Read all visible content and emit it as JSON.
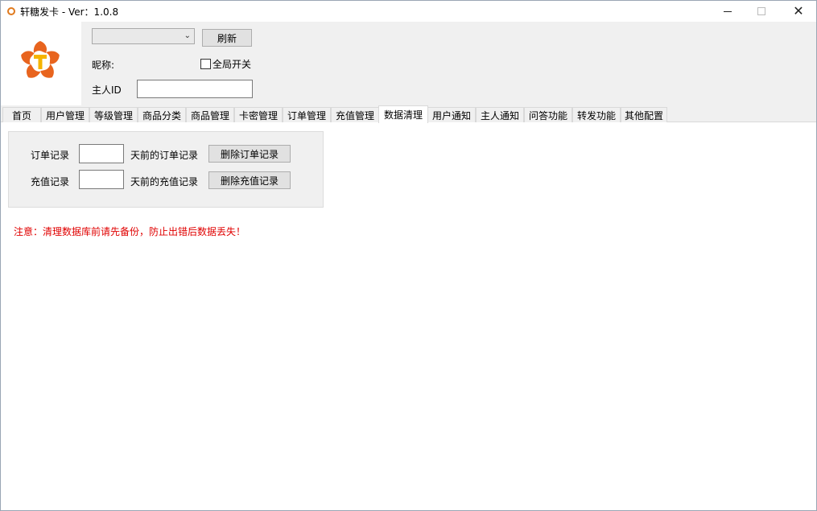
{
  "window": {
    "title": "轩糖发卡 - Ver：1.0.8"
  },
  "header": {
    "combo_value": "",
    "refresh_label": "刷新",
    "nickname_label": "昵称:",
    "global_switch_label": "全局开关",
    "owner_id_label": "主人ID",
    "owner_id_value": ""
  },
  "tabs": [
    {
      "label": "首页"
    },
    {
      "label": "用户管理"
    },
    {
      "label": "等级管理"
    },
    {
      "label": "商品分类"
    },
    {
      "label": "商品管理"
    },
    {
      "label": "卡密管理"
    },
    {
      "label": "订单管理"
    },
    {
      "label": "充值管理"
    },
    {
      "label": "数据清理"
    },
    {
      "label": "用户通知"
    },
    {
      "label": "主人通知"
    },
    {
      "label": "问答功能"
    },
    {
      "label": "转发功能"
    },
    {
      "label": "其他配置"
    }
  ],
  "active_tab": "数据清理",
  "cleanup": {
    "order_label": "订单记录",
    "order_days_value": "",
    "order_suffix": "天前的订单记录",
    "order_button": "删除订单记录",
    "recharge_label": "充值记录",
    "recharge_days_value": "",
    "recharge_suffix": "天前的充值记录",
    "recharge_button": "删除充值记录",
    "warning": "注意：清理数据库前请先备份，防止出错后数据丢失！"
  },
  "colors": {
    "warning": "#e00000",
    "logo_orange": "#e8641e",
    "logo_yellow": "#f5b400"
  },
  "icons": {
    "app": "app-icon",
    "logo": "logo-icon"
  }
}
